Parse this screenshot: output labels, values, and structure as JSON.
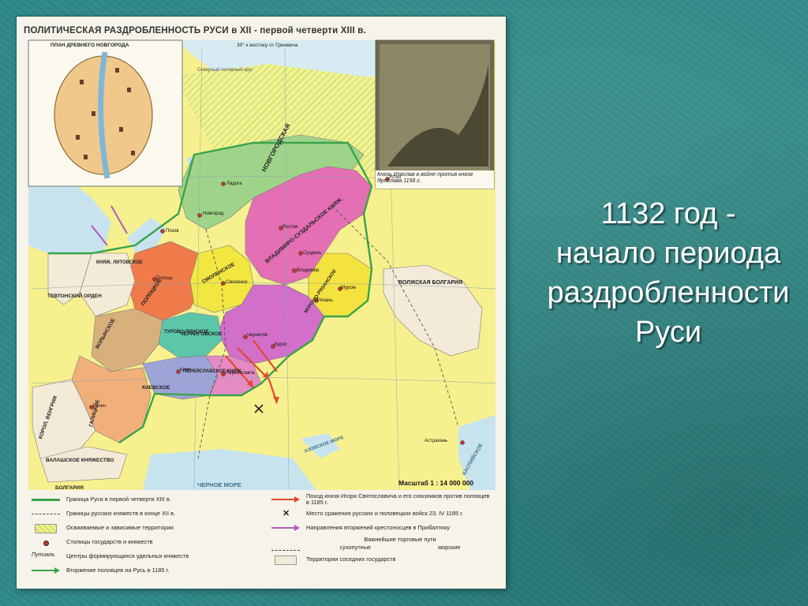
{
  "slide": {
    "text_lines": [
      "1132 год -",
      "начало периода",
      "раздробленности",
      "Руси"
    ]
  },
  "map": {
    "title": "ПОЛИТИЧЕСКАЯ РАЗДРОБЛЕННОСТЬ РУСИ в XII - первой четверти XIII в.",
    "inset_city_title": "ПЛАН ДРЕВНЕГО НОВГОРОДА",
    "inset_picture_caption": "Князь Изяслав в войне против князя Ярослава 1158 г.",
    "meridian_label": "30° к востоку от Гринвича",
    "scale": "Масштаб 1 : 14 000 000",
    "regions": [
      {
        "id": "novgorod",
        "label": "НОВГОРОДСКАЯ",
        "color": "#9fd38a"
      },
      {
        "id": "vladimir",
        "label": "ВЛАДИМИРО-СУЗДАЛЬСКОЕ КНЯЖ.",
        "color": "#e46fb4"
      },
      {
        "id": "polotsk",
        "label": "ПОЛОЦКОЕ",
        "color": "#ef7a4a"
      },
      {
        "id": "smolensk",
        "label": "СМОЛЕНСКОЕ",
        "color": "#f2e640"
      },
      {
        "id": "chernigov",
        "label": "ЧЕРНИГОВСКОЕ",
        "color": "#d16fc9"
      },
      {
        "id": "galich",
        "label": "ГАЛИЦКОЕ",
        "color": "#f1b07a"
      },
      {
        "id": "volyn",
        "label": "ВОЛЫНСКОЕ",
        "color": "#d8b07c"
      },
      {
        "id": "turov",
        "label": "ТУРОВО-ПИНСКОЕ",
        "color": "#5cc6a8"
      },
      {
        "id": "kiev",
        "label": "КИЕВСКОЕ",
        "color": "#9ea4d8"
      },
      {
        "id": "pereyaslavl",
        "label": "ПЕРЕЯСЛАВСКОЕ КНЯЖ.",
        "color": "#e68ac4"
      },
      {
        "id": "ryazan",
        "label": "МУРОМО-РЯЗАНСКОЕ",
        "color": "#f4e23f"
      },
      {
        "id": "volga_bulgaria",
        "label": "ВОЛЖСКАЯ БОЛГАРИЯ",
        "color": "#f3ead8"
      }
    ],
    "other_labels": {
      "teutonic": "ТЕВТОНСКИЙ ОРДЕН",
      "lithuania": "КНЯЖ. ЛИТОВСКОЕ",
      "hungary": "КОРОЛ. ВЕНГРИЯ",
      "wallachia": "ВАЛАШСКОЕ КНЯЖЕСТВО",
      "bulgaria": "БОЛГАРИЯ",
      "black_sea": "ЧЕРНОЕ МОРЕ",
      "azov_sea": "АЗОВСКОЕ МОРЕ",
      "caspian": "КАСПИЙСКОЕ",
      "severnaya": "Северный полярный круг"
    },
    "cities": [
      {
        "name": "Новгород"
      },
      {
        "name": "Псков"
      },
      {
        "name": "Ладога"
      },
      {
        "name": "Полоцк"
      },
      {
        "name": "Смоленск"
      },
      {
        "name": "Владимир"
      },
      {
        "name": "Ростов"
      },
      {
        "name": "Суздаль"
      },
      {
        "name": "Муром"
      },
      {
        "name": "Чернигов"
      },
      {
        "name": "Киев"
      },
      {
        "name": "Переяславль"
      },
      {
        "name": "Галич"
      },
      {
        "name": "Курск"
      },
      {
        "name": "Рязань"
      },
      {
        "name": "Устюг"
      },
      {
        "name": "Астрахань"
      }
    ],
    "legend": {
      "left": [
        "Граница Руси в первой четверти XIII в.",
        "Границы русских княжеств в конце XII в.",
        "Осваиваемые и зависимые территории",
        "Столицы государств и княжеств",
        "Центры формирующихся удельных княжеств",
        "Вторжение половцев на Русь в 1185 г."
      ],
      "left_symbol_text": "Путивль",
      "right": [
        "Поход князя Игоря Святославича и его союзников против половцев в 1185 г.",
        "Место сражения русских и половецких войск 23. IV 1185 г.",
        "Направления вторжений крестоносцев в Прибалтику",
        "Важнейшие торговые пути",
        "сухопутные",
        "морские",
        "Территории соседних государств"
      ]
    }
  }
}
